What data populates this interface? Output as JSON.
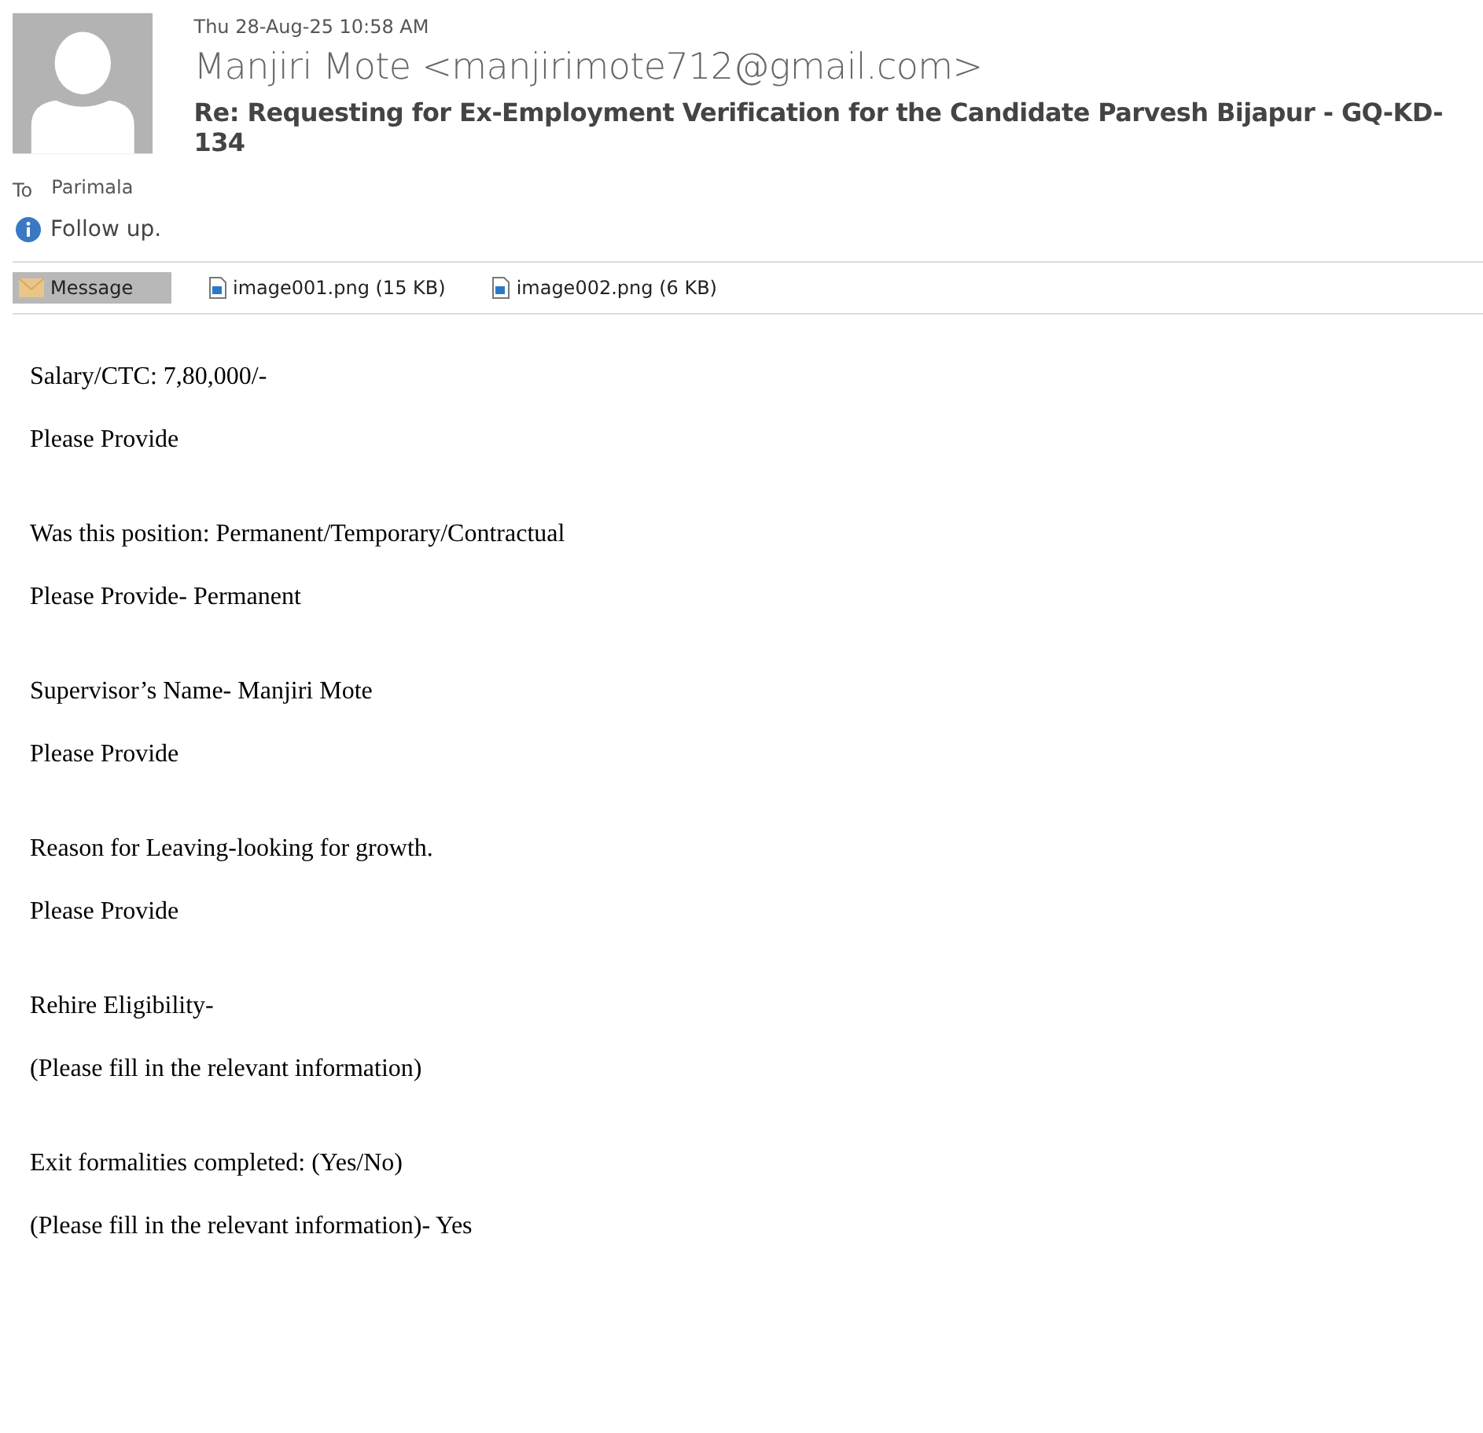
{
  "header": {
    "date": "Thu 28-Aug-25 10:58 AM",
    "sender": "Manjiri Mote <manjirimote712@gmail.com>",
    "subject": "Re: Requesting for Ex-Employment Verification for the Candidate Parvesh Bijapur - GQ-KD-134",
    "to_label": "To",
    "to": "Parimala",
    "info": "Follow up."
  },
  "attachments": [
    {
      "kind": "message",
      "label": "Message",
      "selected": true
    },
    {
      "kind": "file",
      "label": "image001.png (15 KB)",
      "selected": false
    },
    {
      "kind": "file",
      "label": "image002.png (6 KB)",
      "selected": false
    }
  ],
  "body": [
    [
      "Salary/CTC: 7,80,000/-",
      "Please Provide"
    ],
    [
      "Was this position: Permanent/Temporary/Contractual",
      "Please Provide- Permanent"
    ],
    [
      "Supervisor’s Name- Manjiri Mote",
      "Please Provide"
    ],
    [
      "Reason for Leaving-looking for growth.",
      "Please Provide"
    ],
    [
      "Rehire Eligibility-",
      "(Please fill in the relevant information)"
    ],
    [
      "Exit formalities completed: (Yes/No)",
      "(Please fill in the relevant information)- Yes"
    ]
  ]
}
